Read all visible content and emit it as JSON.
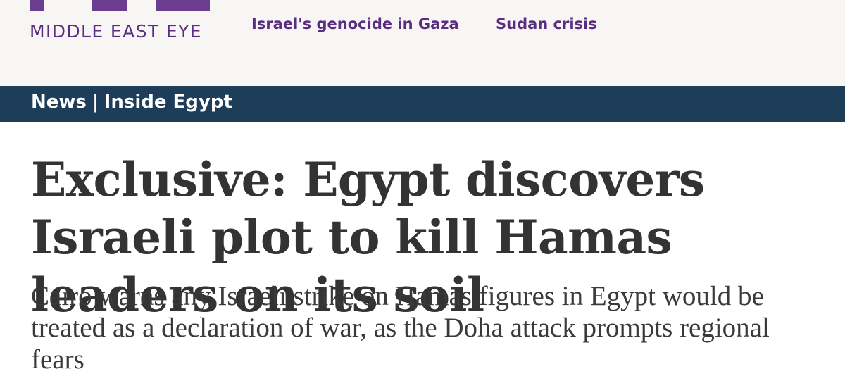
{
  "header": {
    "logo_text": "MIDDLE EAST EYE",
    "nav": [
      {
        "label": "Israel's genocide in Gaza"
      },
      {
        "label": "Sudan crisis"
      }
    ]
  },
  "section": {
    "category": "News",
    "separator": "|",
    "subcategory": "Inside Egypt"
  },
  "article": {
    "headline": "Exclusive: Egypt discovers Israeli plot to kill Hamas leaders on its soil",
    "standfirst": "Cairo warns any Israeli strike on Hamas figures in Egypt would be treated as a declaration of war, as the Doha attack prompts regional fears"
  },
  "colors": {
    "brand_purple": "#5a2d82",
    "section_bar": "#1d3d59",
    "header_bg": "#f7f6f5",
    "headline_text": "#333333"
  }
}
